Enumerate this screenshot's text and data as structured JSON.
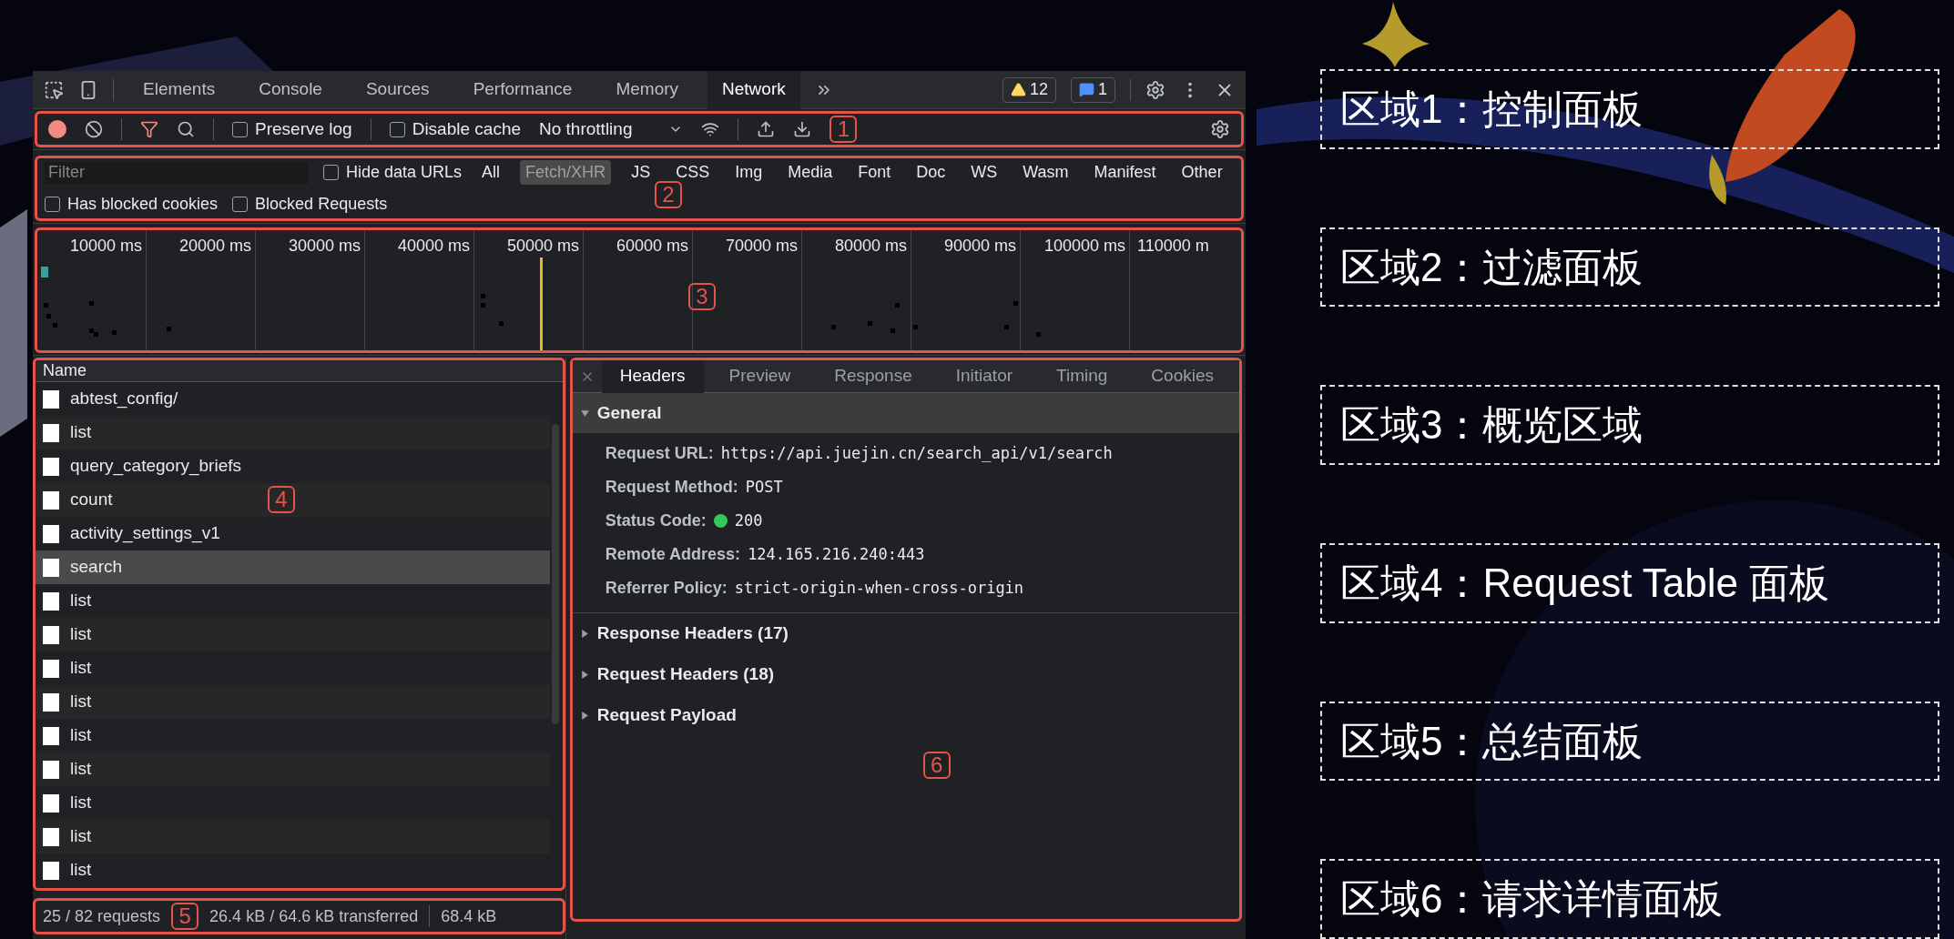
{
  "devtools": {
    "tabs": [
      {
        "label": "Elements",
        "selected": false
      },
      {
        "label": "Console",
        "selected": false
      },
      {
        "label": "Sources",
        "selected": false
      },
      {
        "label": "Performance",
        "selected": false
      },
      {
        "label": "Memory",
        "selected": false
      },
      {
        "label": "Network",
        "selected": true
      }
    ],
    "warnings": "12",
    "messages": "1"
  },
  "toolbar": {
    "marker": "1",
    "preserve_log": {
      "label": "Preserve log",
      "checked": false
    },
    "disable_cache": {
      "label": "Disable cache",
      "checked": false
    },
    "throttling": "No throttling"
  },
  "filter": {
    "marker": "2",
    "placeholder": "Filter",
    "hide_data_urls": {
      "label": "Hide data URLs",
      "checked": false
    },
    "types": [
      {
        "label": "All",
        "selected": false
      },
      {
        "label": "Fetch/XHR",
        "selected": true
      },
      {
        "label": "JS",
        "selected": false
      },
      {
        "label": "CSS",
        "selected": false
      },
      {
        "label": "Img",
        "selected": false
      },
      {
        "label": "Media",
        "selected": false
      },
      {
        "label": "Font",
        "selected": false
      },
      {
        "label": "Doc",
        "selected": false
      },
      {
        "label": "WS",
        "selected": false
      },
      {
        "label": "Wasm",
        "selected": false
      },
      {
        "label": "Manifest",
        "selected": false
      },
      {
        "label": "Other",
        "selected": false
      }
    ],
    "has_blocked_cookies": {
      "label": "Has blocked cookies",
      "checked": false
    },
    "blocked_requests": {
      "label": "Blocked Requests",
      "checked": false
    }
  },
  "overview": {
    "marker": "3",
    "ticks": [
      "10000 ms",
      "20000 ms",
      "30000 ms",
      "40000 ms",
      "50000 ms",
      "60000 ms",
      "70000 ms",
      "80000 ms",
      "90000 ms",
      "100000 ms",
      "110000 m"
    ]
  },
  "requests": {
    "marker": "4",
    "column": "Name",
    "rows": [
      {
        "name": "abtest_config/",
        "selected": false
      },
      {
        "name": "list",
        "selected": false
      },
      {
        "name": "query_category_briefs",
        "selected": false
      },
      {
        "name": "count",
        "selected": false
      },
      {
        "name": "activity_settings_v1",
        "selected": false
      },
      {
        "name": "search",
        "selected": true
      },
      {
        "name": "list",
        "selected": false
      },
      {
        "name": "list",
        "selected": false
      },
      {
        "name": "list",
        "selected": false
      },
      {
        "name": "list",
        "selected": false
      },
      {
        "name": "list",
        "selected": false
      },
      {
        "name": "list",
        "selected": false
      },
      {
        "name": "list",
        "selected": false
      },
      {
        "name": "list",
        "selected": false
      },
      {
        "name": "list",
        "selected": false
      }
    ]
  },
  "summary": {
    "marker": "5",
    "requests": "25 / 82 requests",
    "transferred": "26.4 kB / 64.6 kB transferred",
    "resources": "68.4 kB"
  },
  "details": {
    "marker": "6",
    "tabs": [
      {
        "label": "Headers",
        "selected": true
      },
      {
        "label": "Preview",
        "selected": false
      },
      {
        "label": "Response",
        "selected": false
      },
      {
        "label": "Initiator",
        "selected": false
      },
      {
        "label": "Timing",
        "selected": false
      },
      {
        "label": "Cookies",
        "selected": false
      }
    ],
    "general": {
      "title": "General",
      "expanded": true,
      "fields": [
        {
          "label": "Request URL:",
          "value": "https://api.juejin.cn/search_api/v1/search"
        },
        {
          "label": "Request Method:",
          "value": "POST"
        },
        {
          "label": "Status Code:",
          "value": "200",
          "kind": "status"
        },
        {
          "label": "Remote Address:",
          "value": "124.165.216.240:443"
        },
        {
          "label": "Referrer Policy:",
          "value": "strict-origin-when-cross-origin"
        }
      ]
    },
    "sections": [
      {
        "title": "Response Headers (17)",
        "expanded": false
      },
      {
        "title": "Request Headers (18)",
        "expanded": false
      },
      {
        "title": "Request Payload",
        "expanded": false
      }
    ]
  },
  "legend": [
    "区域1：控制面板",
    "区域2：过滤面板",
    "区域3：概览区域",
    "区域4：Request Table 面板",
    "区域5：总结面板",
    "区域6：请求详情面板"
  ]
}
